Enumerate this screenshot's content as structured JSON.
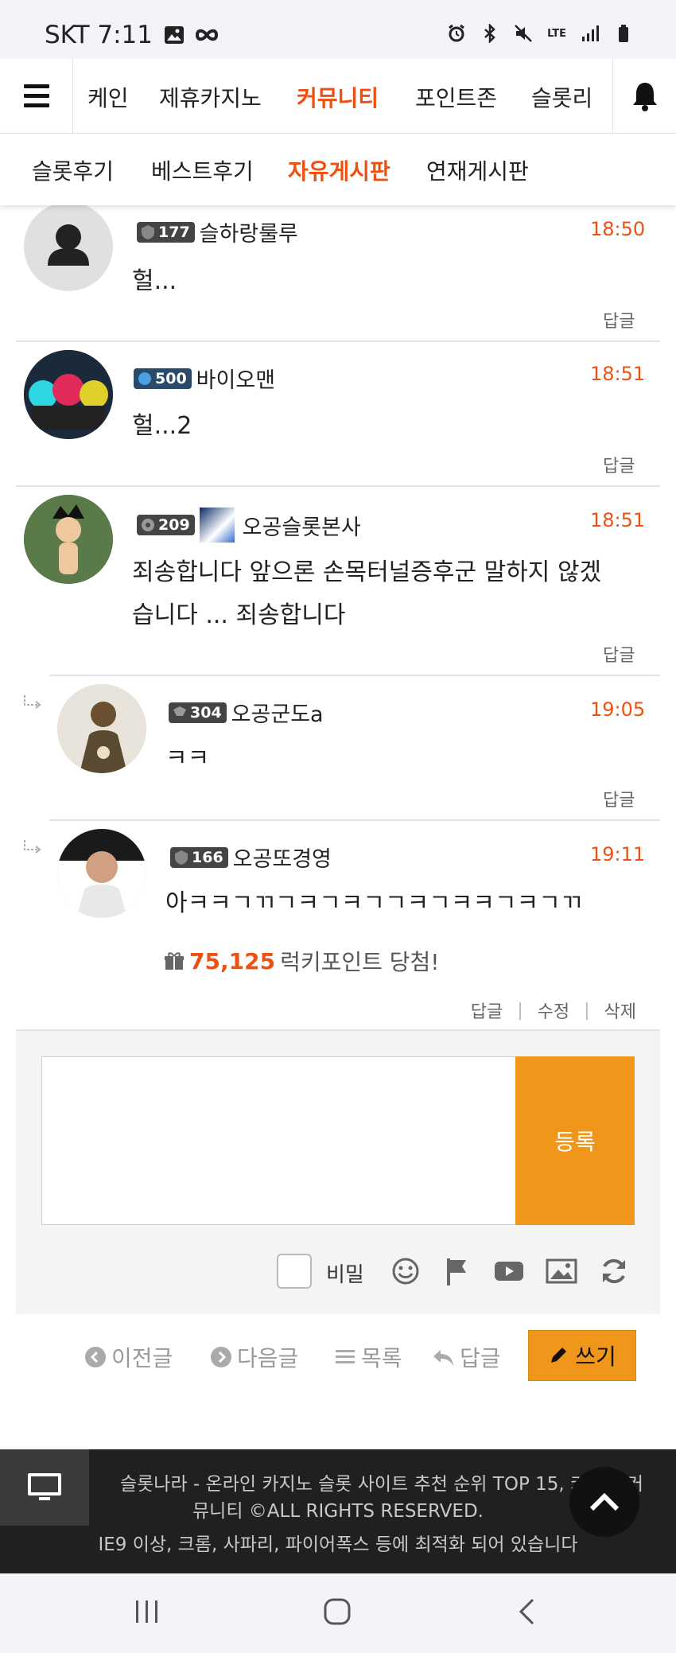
{
  "status": {
    "carrier_time": "SKT 7:11",
    "net": "LTE"
  },
  "topnav": {
    "items": [
      "케인",
      "제휴카지노",
      "커뮤니티",
      "포인트존",
      "슬롯리"
    ]
  },
  "subnav": {
    "items": [
      "슬롯후기",
      "베스트후기",
      "자유게시판",
      "연재게시판"
    ]
  },
  "comments": [
    {
      "level": "177",
      "name": "슬하랑룰루",
      "time": "18:50",
      "text": "헐...",
      "reply": "답글"
    },
    {
      "level": "500",
      "name": "바이오맨",
      "time": "18:51",
      "text": "헐...2",
      "reply": "답글"
    },
    {
      "level": "209",
      "name": "오공슬롯본사",
      "time": "18:51",
      "text_line1": "죄송합니다 앞으론 손목터널증후군 말하지 않겠",
      "text_line2": "습니다 ... 죄송합니다",
      "reply": "답글"
    },
    {
      "level": "304",
      "name": "오공군도a",
      "time": "19:05",
      "text": "ㅋㅋ",
      "reply": "답글"
    },
    {
      "level": "166",
      "name": "오공또경영",
      "time": "19:11",
      "text": "아ㅋㅋㄱㄲㄱㅋㄱㅋㄱㄱㅋㄱㅋㅋㄱㅋㄱㄲ",
      "lucky_points": "75,125",
      "lucky_text": "럭키포인트 당첨!",
      "actions": [
        "답글",
        "수정",
        "삭제"
      ]
    }
  ],
  "form": {
    "submit": "등록",
    "secret_label": "비밀"
  },
  "bottom_nav": {
    "prev": "이전글",
    "next": "다음글",
    "list": "목록",
    "reply": "답글",
    "write": "쓰기"
  },
  "footer": {
    "line1": "슬롯나라 - 온라인 카지노 슬롯 사이트 추천 순위 TOP 15, 카지노 커",
    "line2": "뮤니티 ©ALL RIGHTS RESERVED.",
    "line3": "IE9 이상, 크롬, 사파리, 파이어폭스 등에 최적화 되어 있습니다"
  },
  "colors": {
    "accent": "#f0500f",
    "button": "#f0961b"
  }
}
